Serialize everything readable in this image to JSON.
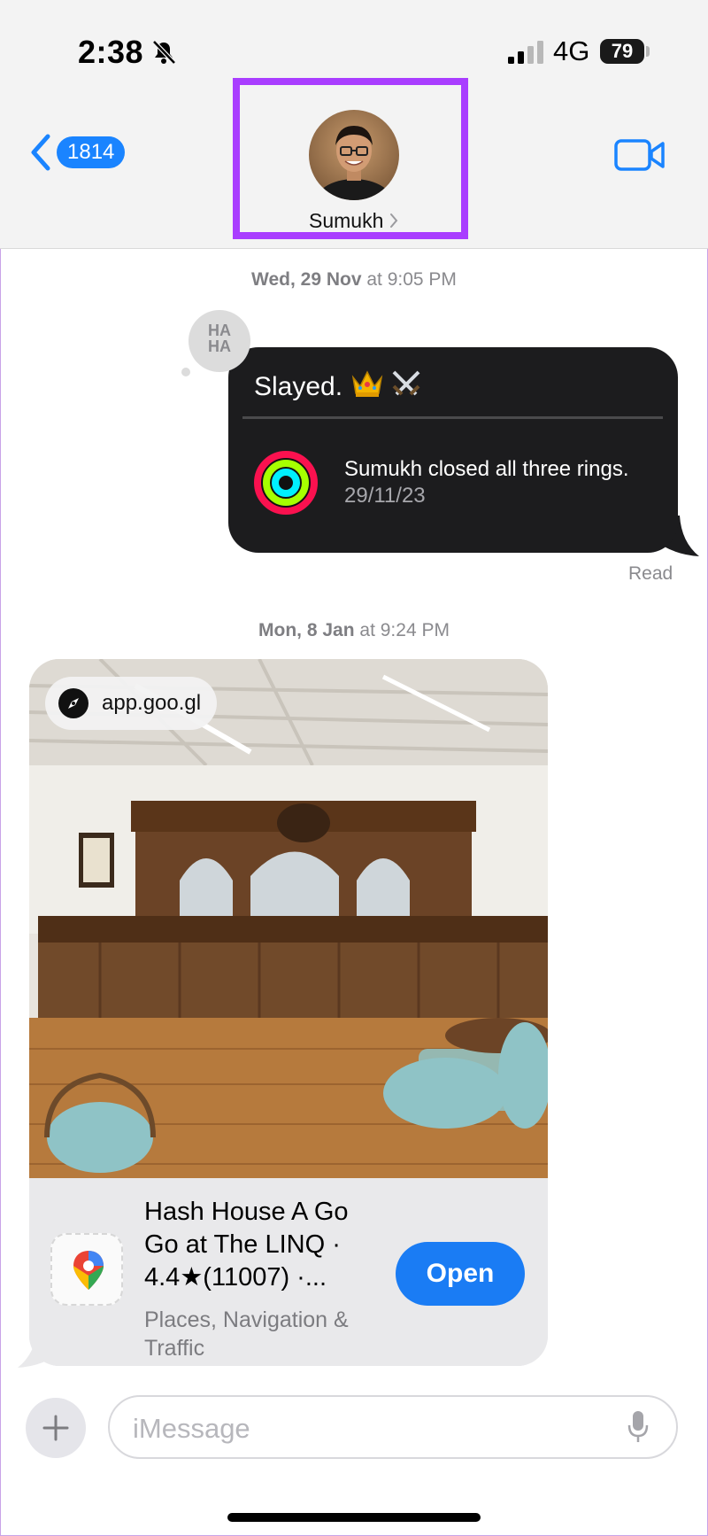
{
  "status_bar": {
    "time": "2:38",
    "network": "4G",
    "battery": "79"
  },
  "nav": {
    "back_count": "1814",
    "contact_name": "Sumukh"
  },
  "thread": {
    "timestamp_1": {
      "day": "Wed, 29 Nov",
      "time": "at 9:05 PM"
    },
    "reaction": "HA HA",
    "message_1": {
      "text": "Slayed.",
      "activity_title": "Sumukh closed all three rings.",
      "activity_date": "29/11/23"
    },
    "read_receipt": "Read",
    "timestamp_2": {
      "day": "Mon, 8 Jan",
      "time": "at 9:24 PM"
    },
    "link_preview": {
      "domain": "app.goo.gl",
      "title": "Hash House A Go Go at The LINQ · 4.4★(11007) ·...",
      "subtitle": "Places, Navigation & Traffic",
      "open_label": "Open"
    }
  },
  "compose": {
    "placeholder": "iMessage"
  },
  "colors": {
    "accent": "#1a84ff",
    "highlight": "#a93dff",
    "dark_bubble": "#1c1c1e"
  }
}
